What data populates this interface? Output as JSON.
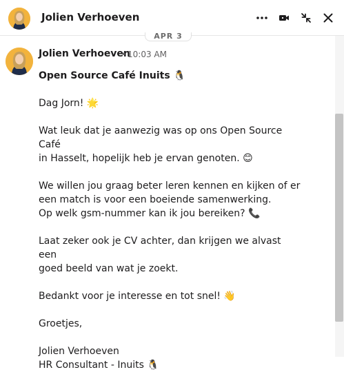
{
  "header": {
    "name": "Jolien Verhoeven",
    "icons": [
      "more-icon",
      "video-icon",
      "collapse-icon",
      "close-icon"
    ]
  },
  "date_divider": "APR 3",
  "message": {
    "sender": "Jolien Verhoeven",
    "separator": "•",
    "time": "10:03 AM",
    "subject": "Open Source Café Inuits 🐧",
    "lines": [
      [
        "Dag Jorn! 🌟"
      ],
      [
        "Wat leuk dat je aanwezig was op ons Open Source Café",
        "in Hasselt, hopelijk heb je ervan genoten. 😊"
      ],
      [
        "We willen jou graag beter leren kennen en kijken of er",
        "een match is voor een boeiende samenwerking.",
        "Op welk gsm-nummer kan ik jou bereiken? 📞"
      ],
      [
        "Laat zeker ook je CV achter, dan krijgen we alvast een",
        "goed beeld van wat je zoekt."
      ],
      [
        "Bedankt voor je interesse en tot snel! 👋"
      ],
      [
        "Groetjes,"
      ],
      [
        "Jolien Verhoeven",
        "HR Consultant - Inuits 🐧"
      ]
    ]
  },
  "colors": {
    "text": "#1d1c1d",
    "muted": "#616061",
    "avatar_bg": "#f2b33d",
    "scroll_thumb": "#c4c4c4"
  }
}
